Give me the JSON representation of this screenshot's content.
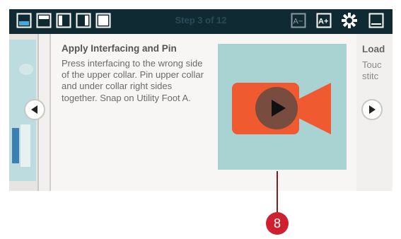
{
  "toolbar": {
    "step_label": "Step 3 of 12",
    "icons": [
      "layout-bottom-icon",
      "layout-top-icon",
      "layout-left-icon",
      "layout-right-icon",
      "layout-full-icon",
      "font-smaller-icon",
      "font-larger-icon",
      "close-icon",
      "minimize-icon"
    ],
    "font_smaller_label": "A−",
    "font_larger_label": "A+"
  },
  "step": {
    "title": "Apply Interfacing and Pin",
    "body": "Press interfacing to the wrong side of the upper collar. Pin upper collar and under collar right sides together. Snap on Utility Foot A."
  },
  "next_step": {
    "title": "Load",
    "body_lines": [
      "Touc",
      "stitc"
    ]
  },
  "video": {
    "icon": "play-icon",
    "bg_color": "#a9d3d2",
    "camera_color": "#ef5a31"
  },
  "callout": {
    "number": "8",
    "color": "#cf2030"
  }
}
